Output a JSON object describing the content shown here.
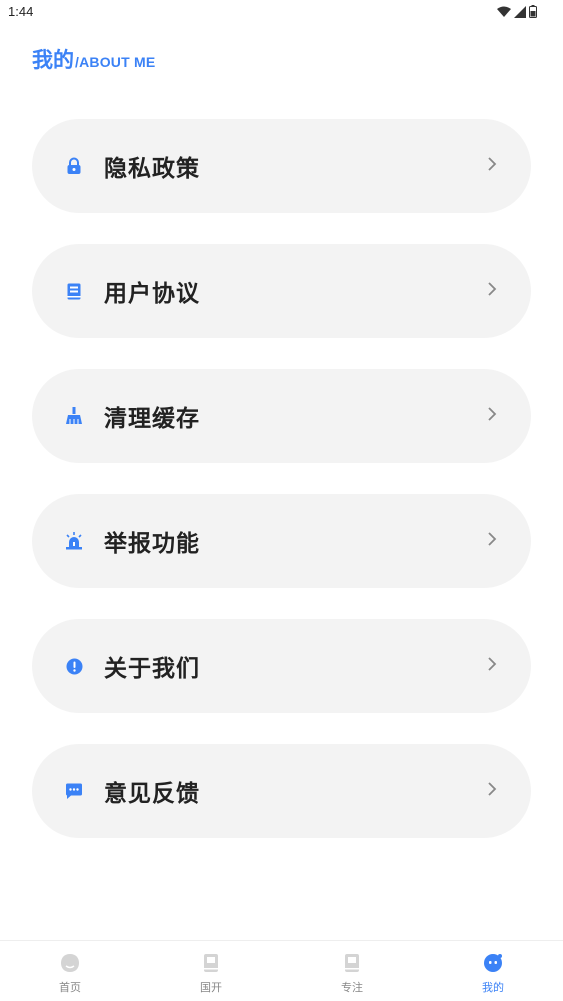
{
  "status_bar": {
    "time": "1:44"
  },
  "header": {
    "title_cn": "我的",
    "title_en": "/ABOUT ME"
  },
  "menu": [
    {
      "label": "隐私政策",
      "icon": "lock-icon"
    },
    {
      "label": "用户协议",
      "icon": "document-icon"
    },
    {
      "label": "清理缓存",
      "icon": "broom-icon"
    },
    {
      "label": "举报功能",
      "icon": "alarm-icon"
    },
    {
      "label": "关于我们",
      "icon": "info-icon"
    },
    {
      "label": "意见反馈",
      "icon": "feedback-icon"
    }
  ],
  "bottom_nav": [
    {
      "label": "首页",
      "icon": "home-icon",
      "active": false
    },
    {
      "label": "国开",
      "icon": "book-icon",
      "active": false
    },
    {
      "label": "专注",
      "icon": "bookmark-icon",
      "active": false
    },
    {
      "label": "我的",
      "icon": "profile-icon",
      "active": true
    }
  ],
  "colors": {
    "accent": "#3b82f6",
    "card": "#f3f3f3",
    "text": "#222222",
    "inactive": "#888888"
  }
}
